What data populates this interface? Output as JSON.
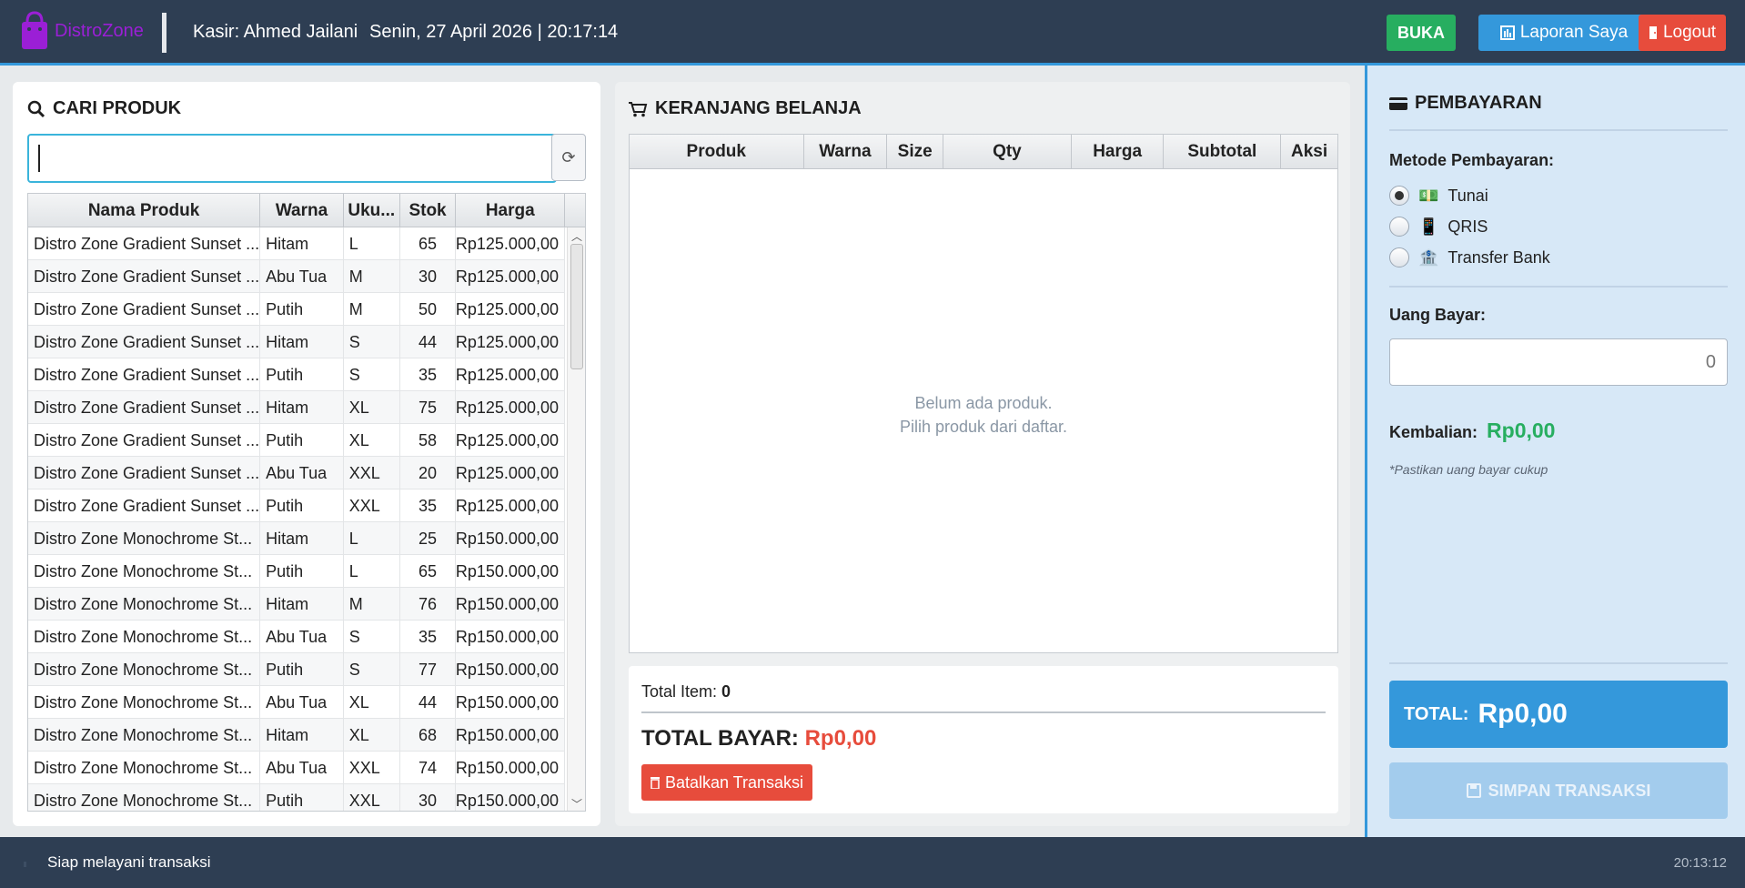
{
  "header": {
    "brand": "DistroZone",
    "cashier": "Kasir: Ahmed Jailani",
    "datetime": "Senin, 27 April 2026 | 20:17:14",
    "buka_label": "BUKA",
    "laporan_label": "Laporan Saya",
    "logout_label": "Logout",
    "colors": {
      "header_bg": "#2e3e53",
      "brand": "#9b1fd6",
      "buka": "#27ae60",
      "laporan": "#3498db",
      "logout": "#e74c3c"
    }
  },
  "product_panel": {
    "title": "CARI PRODUK",
    "search_value": "",
    "refresh_icon": "refresh-icon",
    "columns": [
      "Nama Produk",
      "Warna",
      "Uku...",
      "Stok",
      "Harga"
    ],
    "rows": [
      [
        "Distro Zone Gradient Sunset ...",
        "Hitam",
        "L",
        "65",
        "Rp125.000,00"
      ],
      [
        "Distro Zone Gradient Sunset ...",
        "Abu Tua",
        "M",
        "30",
        "Rp125.000,00"
      ],
      [
        "Distro Zone Gradient Sunset ...",
        "Putih",
        "M",
        "50",
        "Rp125.000,00"
      ],
      [
        "Distro Zone Gradient Sunset ...",
        "Hitam",
        "S",
        "44",
        "Rp125.000,00"
      ],
      [
        "Distro Zone Gradient Sunset ...",
        "Putih",
        "S",
        "35",
        "Rp125.000,00"
      ],
      [
        "Distro Zone Gradient Sunset ...",
        "Hitam",
        "XL",
        "75",
        "Rp125.000,00"
      ],
      [
        "Distro Zone Gradient Sunset ...",
        "Putih",
        "XL",
        "58",
        "Rp125.000,00"
      ],
      [
        "Distro Zone Gradient Sunset ...",
        "Abu Tua",
        "XXL",
        "20",
        "Rp125.000,00"
      ],
      [
        "Distro Zone Gradient Sunset ...",
        "Putih",
        "XXL",
        "35",
        "Rp125.000,00"
      ],
      [
        "Distro Zone Monochrome St...",
        "Hitam",
        "L",
        "25",
        "Rp150.000,00"
      ],
      [
        "Distro Zone Monochrome St...",
        "Putih",
        "L",
        "65",
        "Rp150.000,00"
      ],
      [
        "Distro Zone Monochrome St...",
        "Hitam",
        "M",
        "76",
        "Rp150.000,00"
      ],
      [
        "Distro Zone Monochrome St...",
        "Abu Tua",
        "S",
        "35",
        "Rp150.000,00"
      ],
      [
        "Distro Zone Monochrome St...",
        "Putih",
        "S",
        "77",
        "Rp150.000,00"
      ],
      [
        "Distro Zone Monochrome St...",
        "Abu Tua",
        "XL",
        "44",
        "Rp150.000,00"
      ],
      [
        "Distro Zone Monochrome St...",
        "Hitam",
        "XL",
        "68",
        "Rp150.000,00"
      ],
      [
        "Distro Zone Monochrome St...",
        "Abu Tua",
        "XXL",
        "74",
        "Rp150.000,00"
      ],
      [
        "Distro Zone Monochrome St...",
        "Putih",
        "XXL",
        "30",
        "Rp150.000,00"
      ]
    ]
  },
  "cart_panel": {
    "title": "KERANJANG BELANJA",
    "columns": [
      "Produk",
      "Warna",
      "Size",
      "Qty",
      "Harga",
      "Subtotal",
      "Aksi"
    ],
    "empty_line1": "Belum ada produk.",
    "empty_line2": "Pilih produk dari daftar.",
    "total_item_label": "Total Item:",
    "total_item_value": "0",
    "total_bayar_label": "TOTAL BAYAR:",
    "total_bayar_value": "Rp0,00",
    "cancel_label": "Batalkan Transaksi"
  },
  "payment_panel": {
    "title": "PEMBAYARAN",
    "method_label": "Metode Pembayaran:",
    "methods": [
      {
        "label": "Tunai",
        "icon": "cash-icon",
        "selected": true
      },
      {
        "label": "QRIS",
        "icon": "phone-icon",
        "selected": false
      },
      {
        "label": "Transfer Bank",
        "icon": "bank-icon",
        "selected": false
      }
    ],
    "uang_bayar_label": "Uang Bayar:",
    "uang_bayar_placeholder": "0",
    "kembalian_label": "Kembalian:",
    "kembalian_value": "Rp0,00",
    "note": "*Pastikan uang bayar cukup",
    "total_label": "TOTAL:",
    "total_value": "Rp0,00",
    "save_label": "SIMPAN TRANSAKSI"
  },
  "status_bar": {
    "message": "Siap melayani transaksi",
    "time": "20:13:12"
  }
}
